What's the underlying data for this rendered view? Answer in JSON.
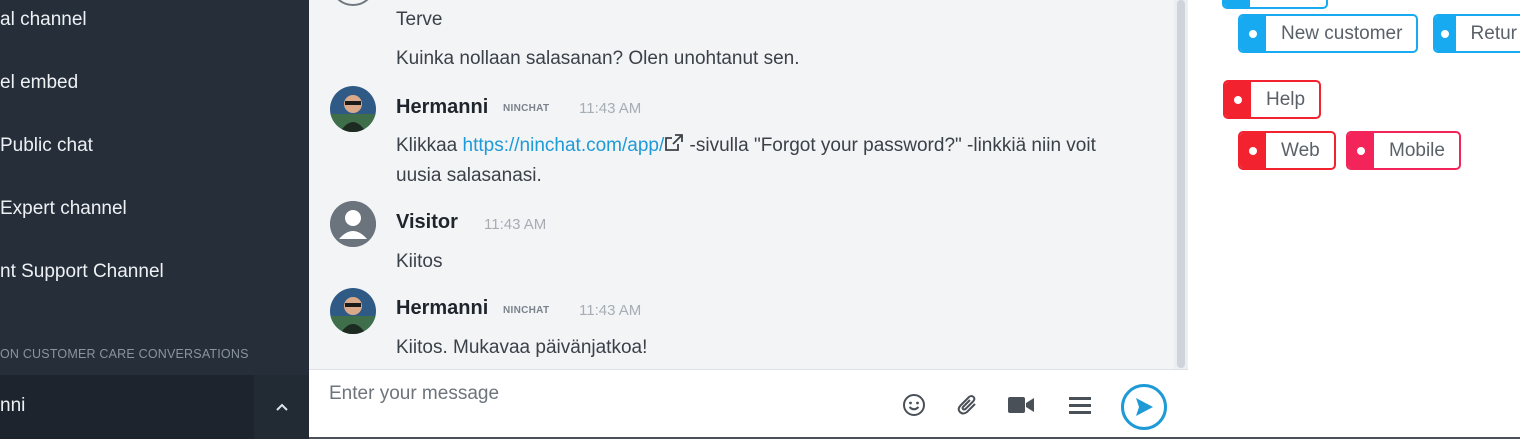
{
  "sidebar": {
    "items": [
      {
        "label": "al channel"
      },
      {
        "label": "el embed"
      },
      {
        "label": "Public chat"
      },
      {
        "label": "Expert channel"
      },
      {
        "label": "nt Support Channel"
      }
    ],
    "section_header": "ON CUSTOMER CARE CONVERSATIONS",
    "bottom_label": "nni"
  },
  "chat": {
    "messages": [
      {
        "text": "Terve"
      },
      {
        "text": "Kuinka nollaan salasanan? Olen unohtanut sen."
      },
      {
        "author": "Hermanni",
        "badge": "NINCHAT",
        "time": "11:43 AM",
        "text_before": "Klikkaa ",
        "link": "https://ninchat.com/app/",
        "text_after_line1": " -sivulla \"Forgot your password?\" -linkkiä niin voit",
        "text_after_line2": "uusia salasanasi."
      },
      {
        "author": "Visitor",
        "time": "11:43 AM",
        "text": "Kiitos"
      },
      {
        "author": "Hermanni",
        "badge": "NINCHAT",
        "time": "11:43 AM",
        "text": "Kiitos. Mukavaa päivänjatkoa!"
      }
    ]
  },
  "input": {
    "placeholder": "Enter your message"
  },
  "tags": [
    {
      "label": "New customer",
      "color": "#18aaf0"
    },
    {
      "label": "Returning customer",
      "display": "Retur",
      "color": "#18aaf0"
    },
    {
      "label": "Help",
      "color": "#f2222f"
    },
    {
      "label": "Web",
      "color": "#f2222f"
    },
    {
      "label": "Mobile",
      "color": "#f2245a"
    }
  ],
  "colors": {
    "sidebar_bg": "#252e39",
    "accent": "#1e9ad6",
    "tag_blue": "#18aaf0",
    "tag_red": "#f2222f"
  }
}
